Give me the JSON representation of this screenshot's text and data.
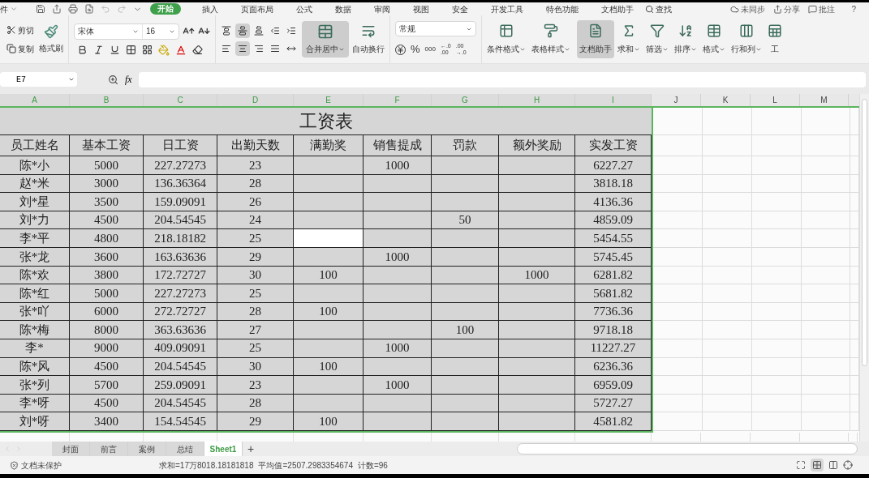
{
  "menu_bar": {
    "items": [
      {
        "label": "件",
        "selected": false
      },
      {
        "label": "开始",
        "selected": true
      },
      {
        "label": "插入",
        "selected": false
      },
      {
        "label": "页面布局",
        "selected": false
      },
      {
        "label": "公式",
        "selected": false
      },
      {
        "label": "数据",
        "selected": false
      },
      {
        "label": "审阅",
        "selected": false
      },
      {
        "label": "视图",
        "selected": false
      },
      {
        "label": "安全",
        "selected": false
      },
      {
        "label": "开发工具",
        "selected": false
      },
      {
        "label": "特色功能",
        "selected": false
      },
      {
        "label": "文档助手",
        "selected": false
      }
    ],
    "search": "查找",
    "right": [
      "未同步",
      "分享",
      "批注"
    ],
    "help": "?"
  },
  "ribbon": {
    "cut": "剪切",
    "copy": "复制",
    "format_painter": "格式刷",
    "font_name": "宋体",
    "font_size": "16",
    "align_top": [
      {
        "kind": "top",
        "selected": false
      },
      {
        "kind": "middle",
        "selected": true
      },
      {
        "kind": "bottom",
        "selected": false
      },
      {
        "kind": "outdent",
        "selected": false
      },
      {
        "kind": "indent",
        "selected": false
      }
    ],
    "align_bottom": [
      {
        "kind": "left",
        "selected": false
      },
      {
        "kind": "center",
        "selected": true
      },
      {
        "kind": "right",
        "selected": false
      },
      {
        "kind": "justify",
        "selected": false
      },
      {
        "kind": "distributed",
        "selected": false
      }
    ],
    "merge": {
      "label": "合并居中",
      "selected": true
    },
    "wrap": "自动换行",
    "number_format": "常规",
    "percent": "%",
    "thousands": "000",
    "inc_decimal": [
      "←.0",
      ".00"
    ],
    "dec_decimal": [
      ".00",
      "→.0"
    ],
    "buttons": [
      {
        "kind": "conditional",
        "label": "条件格式",
        "selected": false,
        "dropdown": true
      },
      {
        "kind": "table_style",
        "label": "表格样式",
        "selected": false,
        "dropdown": true
      },
      {
        "kind": "assistant",
        "label": "文档助手",
        "selected": true,
        "dropdown": false
      },
      {
        "kind": "sum",
        "label": "求和",
        "selected": false,
        "dropdown": true
      },
      {
        "kind": "filter",
        "label": "筛选",
        "selected": false,
        "dropdown": true
      },
      {
        "kind": "sort",
        "label": "排序",
        "selected": false,
        "dropdown": true
      },
      {
        "kind": "format",
        "label": "格式",
        "selected": false,
        "dropdown": true
      },
      {
        "kind": "rows_cols",
        "label": "行和列",
        "selected": false,
        "dropdown": true
      },
      {
        "kind": "sheet",
        "label": "工",
        "selected": false,
        "dropdown": false
      }
    ]
  },
  "formula_bar": {
    "name_box": "E7",
    "fx": "fx"
  },
  "sheet": {
    "columns": [
      {
        "label": "A",
        "selected": true
      },
      {
        "label": "B",
        "selected": true
      },
      {
        "label": "C",
        "selected": true
      },
      {
        "label": "D",
        "selected": true
      },
      {
        "label": "E",
        "selected": true
      },
      {
        "label": "F",
        "selected": true
      },
      {
        "label": "G",
        "selected": true
      },
      {
        "label": "H",
        "selected": true
      },
      {
        "label": "I",
        "selected": true
      },
      {
        "label": "J",
        "selected": false
      },
      {
        "label": "K",
        "selected": false
      },
      {
        "label": "L",
        "selected": false
      },
      {
        "label": "M",
        "selected": false
      }
    ],
    "title": "工资表",
    "headers": [
      "员工姓名",
      "基本工资",
      "日工资",
      "出勤天数",
      "满勤奖",
      "销售提成",
      "罚款",
      "额外奖励",
      "实发工资"
    ],
    "rows": [
      {
        "cells": [
          {
            "text": "陈*小",
            "selected": false
          },
          {
            "text": "5000",
            "selected": false
          },
          {
            "text": "227.27273",
            "selected": false
          },
          {
            "text": "23",
            "selected": false
          },
          {
            "selected": false
          },
          {
            "text": "1000",
            "selected": false
          },
          {
            "selected": false
          },
          {
            "selected": false
          },
          {
            "text": "6227.27",
            "selected": false
          }
        ]
      },
      {
        "cells": [
          {
            "text": "赵*米",
            "selected": false
          },
          {
            "text": "3000",
            "selected": false
          },
          {
            "text": "136.36364",
            "selected": false
          },
          {
            "text": "28",
            "selected": false
          },
          {
            "selected": false
          },
          {
            "selected": false
          },
          {
            "selected": false
          },
          {
            "selected": false
          },
          {
            "text": "3818.18",
            "selected": false
          }
        ]
      },
      {
        "cells": [
          {
            "text": "刘*星",
            "selected": false
          },
          {
            "text": "3500",
            "selected": false
          },
          {
            "text": "159.09091",
            "selected": false
          },
          {
            "text": "26",
            "selected": false
          },
          {
            "selected": false
          },
          {
            "selected": false
          },
          {
            "selected": false
          },
          {
            "selected": false
          },
          {
            "text": "4136.36",
            "selected": false
          }
        ]
      },
      {
        "cells": [
          {
            "text": "刘*力",
            "selected": false
          },
          {
            "text": "4500",
            "selected": false
          },
          {
            "text": "204.54545",
            "selected": false
          },
          {
            "text": "24",
            "selected": false
          },
          {
            "selected": false
          },
          {
            "selected": false
          },
          {
            "text": "50",
            "selected": false
          },
          {
            "selected": false
          },
          {
            "text": "4859.09",
            "selected": false
          }
        ]
      },
      {
        "cells": [
          {
            "text": "李*平",
            "selected": false
          },
          {
            "text": "4800",
            "selected": false
          },
          {
            "text": "218.18182",
            "selected": false
          },
          {
            "text": "25",
            "selected": false
          },
          {
            "selected": true
          },
          {
            "selected": false
          },
          {
            "selected": false
          },
          {
            "selected": false
          },
          {
            "text": "5454.55",
            "selected": false
          }
        ]
      },
      {
        "cells": [
          {
            "text": "张*龙",
            "selected": false
          },
          {
            "text": "3600",
            "selected": false
          },
          {
            "text": "163.63636",
            "selected": false
          },
          {
            "text": "29",
            "selected": false
          },
          {
            "selected": false
          },
          {
            "text": "1000",
            "selected": false
          },
          {
            "selected": false
          },
          {
            "selected": false
          },
          {
            "text": "5745.45",
            "selected": false
          }
        ]
      },
      {
        "cells": [
          {
            "text": "陈*欢",
            "selected": false
          },
          {
            "text": "3800",
            "selected": false
          },
          {
            "text": "172.72727",
            "selected": false
          },
          {
            "text": "30",
            "selected": false
          },
          {
            "text": "100",
            "selected": false
          },
          {
            "selected": false
          },
          {
            "selected": false
          },
          {
            "text": "1000",
            "selected": false
          },
          {
            "text": "6281.82",
            "selected": false
          }
        ]
      },
      {
        "cells": [
          {
            "text": "陈*红",
            "selected": false
          },
          {
            "text": "5000",
            "selected": false
          },
          {
            "text": "227.27273",
            "selected": false
          },
          {
            "text": "25",
            "selected": false
          },
          {
            "selected": false
          },
          {
            "selected": false
          },
          {
            "selected": false
          },
          {
            "selected": false
          },
          {
            "text": "5681.82",
            "selected": false
          }
        ]
      },
      {
        "cells": [
          {
            "text": "张*吖",
            "selected": false
          },
          {
            "text": "6000",
            "selected": false
          },
          {
            "text": "272.72727",
            "selected": false
          },
          {
            "text": "28",
            "selected": false
          },
          {
            "text": "100",
            "selected": false
          },
          {
            "selected": false
          },
          {
            "selected": false
          },
          {
            "selected": false
          },
          {
            "text": "7736.36",
            "selected": false
          }
        ]
      },
      {
        "cells": [
          {
            "text": "陈*梅",
            "selected": false
          },
          {
            "text": "8000",
            "selected": false
          },
          {
            "text": "363.63636",
            "selected": false
          },
          {
            "text": "27",
            "selected": false
          },
          {
            "selected": false
          },
          {
            "selected": false
          },
          {
            "text": "100",
            "selected": false
          },
          {
            "selected": false
          },
          {
            "text": "9718.18",
            "selected": false
          }
        ]
      },
      {
        "cells": [
          {
            "text": "李*",
            "selected": false
          },
          {
            "text": "9000",
            "selected": false
          },
          {
            "text": "409.09091",
            "selected": false
          },
          {
            "text": "25",
            "selected": false
          },
          {
            "selected": false
          },
          {
            "text": "1000",
            "selected": false
          },
          {
            "selected": false
          },
          {
            "selected": false
          },
          {
            "text": "11227.27",
            "selected": false
          }
        ]
      },
      {
        "cells": [
          {
            "text": "陈*风",
            "selected": false
          },
          {
            "text": "4500",
            "selected": false
          },
          {
            "text": "204.54545",
            "selected": false
          },
          {
            "text": "30",
            "selected": false
          },
          {
            "text": "100",
            "selected": false
          },
          {
            "selected": false
          },
          {
            "selected": false
          },
          {
            "selected": false
          },
          {
            "text": "6236.36",
            "selected": false
          }
        ]
      },
      {
        "cells": [
          {
            "text": "张*列",
            "selected": false
          },
          {
            "text": "5700",
            "selected": false
          },
          {
            "text": "259.09091",
            "selected": false
          },
          {
            "text": "23",
            "selected": false
          },
          {
            "selected": false
          },
          {
            "text": "1000",
            "selected": false
          },
          {
            "selected": false
          },
          {
            "selected": false
          },
          {
            "text": "6959.09",
            "selected": false
          }
        ]
      },
      {
        "cells": [
          {
            "text": "李*呀",
            "selected": false
          },
          {
            "text": "4500",
            "selected": false
          },
          {
            "text": "204.54545",
            "selected": false
          },
          {
            "text": "28",
            "selected": false
          },
          {
            "selected": false
          },
          {
            "selected": false
          },
          {
            "selected": false
          },
          {
            "selected": false
          },
          {
            "text": "5727.27",
            "selected": false
          }
        ]
      },
      {
        "cells": [
          {
            "text": "刘*呀",
            "selected": false
          },
          {
            "text": "3400",
            "selected": false
          },
          {
            "text": "154.54545",
            "selected": false
          },
          {
            "text": "29",
            "selected": false
          },
          {
            "text": "100",
            "selected": false
          },
          {
            "selected": false
          },
          {
            "selected": false
          },
          {
            "selected": false
          },
          {
            "text": "4581.82",
            "selected": false
          }
        ]
      }
    ]
  },
  "sheet_tabs": [
    {
      "label": "封面",
      "selected": false
    },
    {
      "label": "前言",
      "selected": false
    },
    {
      "label": "案例",
      "selected": false
    },
    {
      "label": "总结",
      "selected": false
    },
    {
      "label": "Sheet1",
      "selected": true
    }
  ],
  "add_tab": "+",
  "status_bar": {
    "protection": "文档未保护",
    "sum": "求和=17万8018.18181818",
    "average": "平均值=2507.2983354674",
    "count": "计数=96"
  }
}
